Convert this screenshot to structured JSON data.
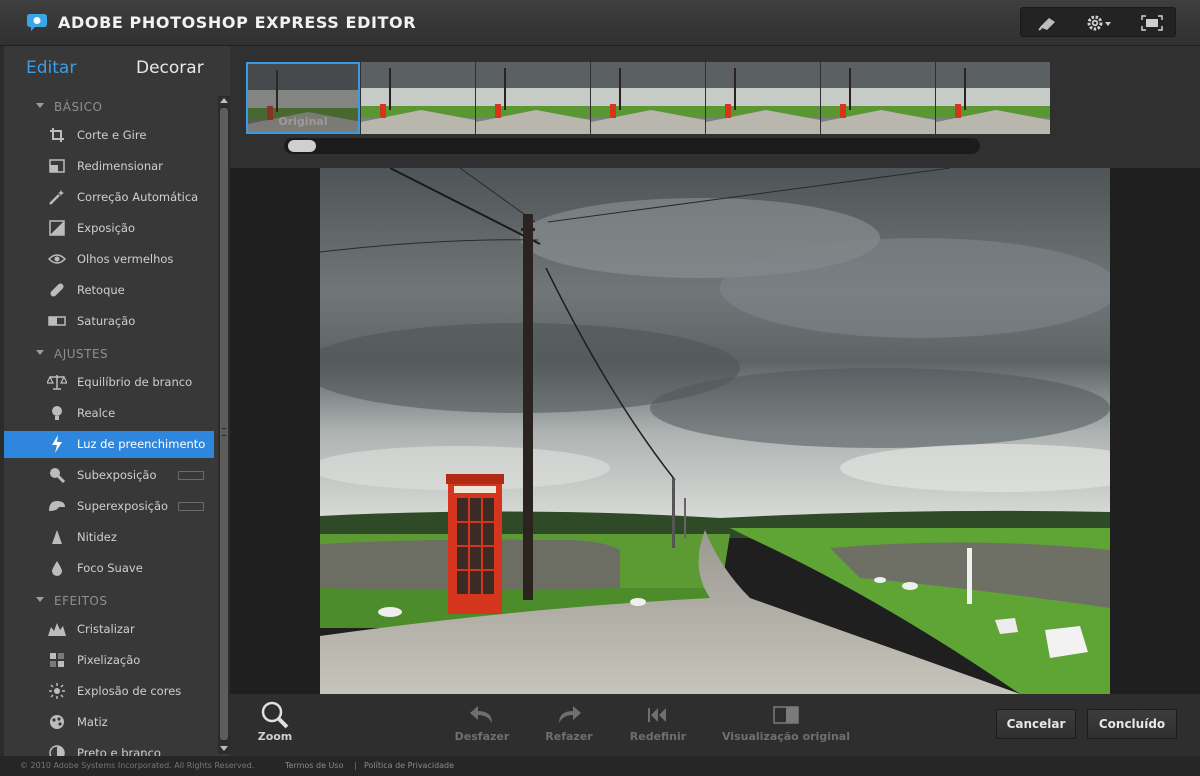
{
  "header": {
    "title": "ADOBE PHOTOSHOP EXPRESS EDITOR",
    "tools": [
      {
        "name": "feedback-icon"
      },
      {
        "name": "gear-icon"
      },
      {
        "name": "fullscreen-icon"
      }
    ]
  },
  "sidebar": {
    "tabs": {
      "edit": "Editar",
      "decorate": "Decorar"
    },
    "sections": [
      {
        "title": "BÁSICO",
        "items": [
          {
            "label": "Corte e Gire",
            "icon": "crop-icon"
          },
          {
            "label": "Redimensionar",
            "icon": "resize-icon"
          },
          {
            "label": "Correção Automática",
            "icon": "magic-wand-icon"
          },
          {
            "label": "Exposição",
            "icon": "exposure-icon"
          },
          {
            "label": "Olhos vermelhos",
            "icon": "eye-icon"
          },
          {
            "label": "Retoque",
            "icon": "bandage-icon"
          },
          {
            "label": "Saturação",
            "icon": "saturation-icon"
          }
        ]
      },
      {
        "title": "AJUSTES",
        "items": [
          {
            "label": "Equilíbrio de branco",
            "icon": "balance-scale-icon"
          },
          {
            "label": "Realce",
            "icon": "lightbulb-icon"
          },
          {
            "label": "Luz de preenchimento",
            "icon": "lightning-icon",
            "active": true
          },
          {
            "label": "Subexposição",
            "icon": "magnifier-icon",
            "badge": true
          },
          {
            "label": "Superexposição",
            "icon": "burn-icon",
            "badge": true
          },
          {
            "label": "Nitidez",
            "icon": "sharpen-icon"
          },
          {
            "label": "Foco Suave",
            "icon": "drop-icon"
          }
        ]
      },
      {
        "title": "EFEITOS",
        "items": [
          {
            "label": "Cristalizar",
            "icon": "crystallize-icon"
          },
          {
            "label": "Pixelização",
            "icon": "pixelate-icon"
          },
          {
            "label": "Explosão de cores",
            "icon": "color-burst-icon"
          },
          {
            "label": "Matiz",
            "icon": "hue-icon"
          },
          {
            "label": "Preto e branco",
            "icon": "black-white-icon"
          }
        ]
      }
    ]
  },
  "thumbnails": {
    "original_label": "Original",
    "count": 7,
    "selected": 0
  },
  "toolbar": {
    "zoom": "Zoom",
    "undo": "Desfazer",
    "redo": "Refazer",
    "reset": "Redefinir",
    "original_view": "Visualização original",
    "cancel": "Cancelar",
    "done": "Concluído"
  },
  "footer": {
    "copyright": "© 2010 Adobe Systems Incorporated. All Rights Reserved.",
    "terms": "Termos de Uso",
    "separator": "|",
    "privacy": "Política de Privacidade"
  },
  "colors": {
    "accent": "#2f86dd",
    "tab_active": "#3b9de6",
    "phone_box_red": "#d4351c"
  }
}
